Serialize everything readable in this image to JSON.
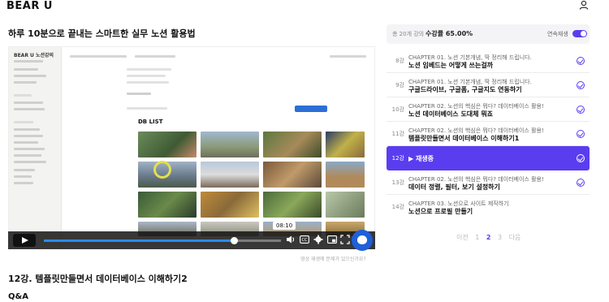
{
  "header": {
    "logo": "BEAR U"
  },
  "course": {
    "title": "하루 10분으로 끝내는 스마트한 실무 노션 활용법"
  },
  "video": {
    "sidebar_title": "BEAR U 노션강의",
    "gallery_title": "DB LIST",
    "time": "08:10",
    "progress": 0.8,
    "report_text": "영상 재생에 문제가 있으신가요?"
  },
  "lecture": {
    "title": "12강. 템플릿만들면서 데이터베이스 이해하기2"
  },
  "qa": {
    "title": "Q&A"
  },
  "panel": {
    "count": "총 20개 강의",
    "rate": "수강률 65.00%",
    "autoplay": "연속재생",
    "autoplay_on": true,
    "accent": "#5b3df0",
    "lessons": [
      {
        "num": "8강",
        "chapter": "CHAPTER 01. 노션 기본개념, 딱 정리해 드립니다.",
        "name": "노션 임베드는 어떻게 쓰는걸까"
      },
      {
        "num": "9강",
        "chapter": "CHAPTER 01. 노션 기본개념, 딱 정리해 드립니다.",
        "name": "구글드라이브, 구글폼, 구글지도 연동하기"
      },
      {
        "num": "10강",
        "chapter": "CHAPTER 02. 노션의 핵심은 뭐다? 데이터베이스 활용!",
        "name": "노션 데이터베이스 도대체 뭐죠"
      },
      {
        "num": "11강",
        "chapter": "CHAPTER 02. 노션의 핵심은 뭐다? 데이터베이스 활용!",
        "name": "템플릿만들면서 데이터베이스 이해하기1"
      },
      {
        "num": "12강",
        "status": "▶ 재생중"
      },
      {
        "num": "13강",
        "chapter": "CHAPTER 02. 노션의 핵심은 뭐다? 데이터베이스 활용!",
        "name": "데이터 정렬, 필터, 보기 설정하기"
      },
      {
        "num": "14강",
        "chapter": "CHAPTER 03. 노션으로 사이트 제작하기",
        "name": "노션으로 프로필 만들기"
      }
    ]
  },
  "pagination": {
    "prev": "이전",
    "pages": [
      "1",
      "2",
      "3"
    ],
    "current": "2",
    "next": "다음"
  }
}
